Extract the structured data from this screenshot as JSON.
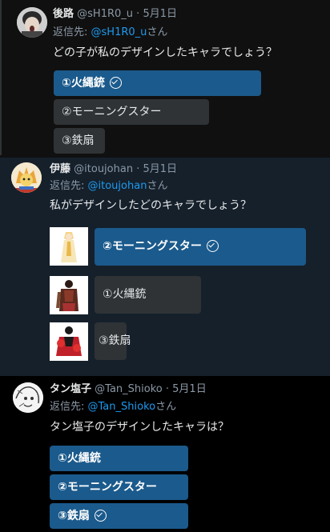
{
  "tweets": [
    {
      "name": "後路",
      "handle": "@sH1R0_u",
      "dot": "·",
      "date": "5月1日",
      "reply_prefix": "返信先: ",
      "reply_to": "@sH1R0_u",
      "reply_suffix": "さん",
      "text": "どの子が私のデザインしたキャラでしょう？",
      "options": [
        {
          "label": "①火縄銃",
          "selected": true
        },
        {
          "label": "②モーニングスター",
          "selected": false
        },
        {
          "label": "③鉄扇",
          "selected": false
        }
      ]
    },
    {
      "name": "伊藤",
      "handle": "@itoujohan",
      "dot": "·",
      "date": "5月1日",
      "reply_prefix": "返信先: ",
      "reply_to": "@itoujohan",
      "reply_suffix": "さん",
      "text": "私がデザインしたどのキャラでしょう？",
      "options": [
        {
          "label": "②モーニングスター",
          "selected": true
        },
        {
          "label": "①火縄銃",
          "selected": false
        },
        {
          "label": "③鉄扇",
          "selected": false
        }
      ]
    },
    {
      "name": "タン塩子",
      "handle": "@Tan_Shioko",
      "dot": "·",
      "date": "5月1日",
      "reply_prefix": "返信先: ",
      "reply_to": "@Tan_Shioko",
      "reply_suffix": "さん",
      "text": "タン塩子のデザインしたキャラは？",
      "options": [
        {
          "label": "①火縄銃",
          "selected": false
        },
        {
          "label": "②モーニングスター",
          "selected": false
        },
        {
          "label": "③鉄扇",
          "selected": true
        }
      ]
    }
  ],
  "colors": {
    "accent": "#1d9bf0",
    "selected_option": "#1b5a8c",
    "plain_option": "#2f3336",
    "muted": "#8b98a5"
  }
}
